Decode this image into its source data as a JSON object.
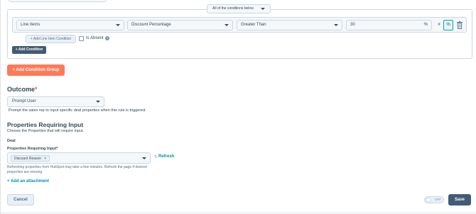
{
  "conditions": {
    "match_mode": "All of the conditions below",
    "rule": {
      "object": "Line items",
      "property": "Discount Percentage",
      "operator": "Greater Than",
      "value": "30",
      "value_suffix": "%",
      "hash_label": "#",
      "percent_label": "%"
    },
    "add_line_item_condition": "+ Add Line Item Condition",
    "is_absent_label": "Is Absent",
    "add_condition": "+ Add Condition",
    "add_condition_group": "+ Add Condition Group"
  },
  "outcome": {
    "title": "Outcome",
    "required_mark": "*",
    "selected": "Prompt User",
    "description": "Prompt the sales rep to input specific deal properties when this rule is triggered."
  },
  "properties": {
    "title": "Properties Requiring Input",
    "description": "Choose the Properties that will require input.",
    "object_label": "Deal",
    "field_label": "Properties Requiring Input*",
    "selected_tags": [
      {
        "label": "Discount Reason",
        "remove": "×"
      }
    ],
    "refresh_icon": "↻",
    "refresh_label": "Refresh",
    "refresh_note": "Refreshing properties from HubSpot may take a few minutes. Refresh the page if desired properties are missing.",
    "add_attachment": "+ Add an attachment"
  },
  "footer": {
    "cancel": "Cancel",
    "toggle_state": "OFF",
    "save": "Save"
  },
  "colors": {
    "accent_orange": "#ff7a59",
    "dark_button": "#425b76",
    "link": "#0091ae",
    "text": "#33475b"
  }
}
